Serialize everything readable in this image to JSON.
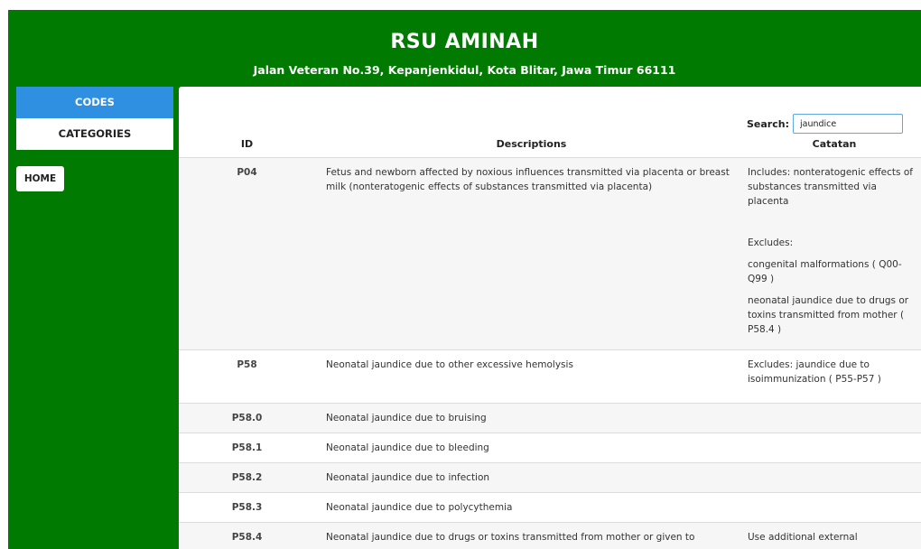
{
  "header": {
    "title": "RSU AMINAH",
    "address": "Jalan Veteran No.39, Kepanjenkidul, Kota Blitar, Jawa Timur 66111"
  },
  "sidebar": {
    "items": [
      {
        "label": "CODES",
        "active": true
      },
      {
        "label": "CATEGORIES",
        "active": false
      }
    ],
    "home_label": "HOME"
  },
  "search": {
    "label": "Search:",
    "value": "jaundice"
  },
  "table": {
    "columns": [
      "ID",
      "Descriptions",
      "Catatan"
    ],
    "rows": [
      {
        "id": "P04",
        "desc": "Fetus and newborn affected by noxious influences transmitted via placenta or breast milk (nonteratogenic effects of substances transmitted via placenta)",
        "notes": [
          "Includes: nonteratogenic effects of substances transmitted via placenta",
          "Excludes:",
          "congenital malformations ( Q00-Q99 )",
          "neonatal jaundice due to drugs or toxins transmitted from mother ( P58.4 )"
        ]
      },
      {
        "id": "P58",
        "desc": "Neonatal jaundice due to other excessive hemolysis",
        "notes": [
          "Excludes: jaundice due to isoimmunization ( P55-P57 )"
        ]
      },
      {
        "id": "P58.0",
        "desc": "Neonatal jaundice due to bruising",
        "notes": []
      },
      {
        "id": "P58.1",
        "desc": "Neonatal jaundice due to bleeding",
        "notes": []
      },
      {
        "id": "P58.2",
        "desc": "Neonatal jaundice due to infection",
        "notes": []
      },
      {
        "id": "P58.3",
        "desc": "Neonatal jaundice due to polycythemia",
        "notes": []
      },
      {
        "id": "P58.4",
        "desc": "Neonatal jaundice due to drugs or toxins transmitted from mother or given to",
        "notes": [
          "Use additional external"
        ]
      }
    ]
  },
  "colors": {
    "brand_green": "#007a00",
    "active_blue": "#2f8fe0"
  }
}
